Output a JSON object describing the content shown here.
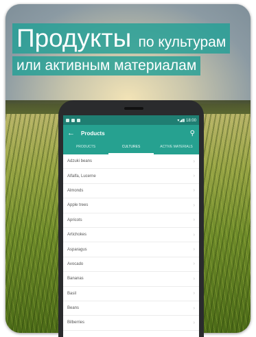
{
  "banner": {
    "line1_big": "Продукты",
    "line1_small": "по культурам",
    "line2": "или активным материалам"
  },
  "status_bar": {
    "time": "18:00"
  },
  "app_bar": {
    "title": "Products",
    "back_icon": "arrow-left-icon",
    "search_icon": "search-icon"
  },
  "tabs": [
    {
      "label": "PRODUCTS",
      "active": false
    },
    {
      "label": "CULTURES",
      "active": true
    },
    {
      "label": "ACTIVE MATERIALS",
      "active": false
    }
  ],
  "list_items": [
    "Adzuki beans",
    "Alfalfa, Lucerne",
    "Almonds",
    "Apple trees",
    "Apricots",
    "Artichokes",
    "Asparagus",
    "Avocado",
    "Bananas",
    "Basil",
    "Beans",
    "Bilberries"
  ],
  "colors": {
    "teal_dark": "#1f7e72",
    "teal": "#26a190",
    "banner": "#23a096"
  }
}
